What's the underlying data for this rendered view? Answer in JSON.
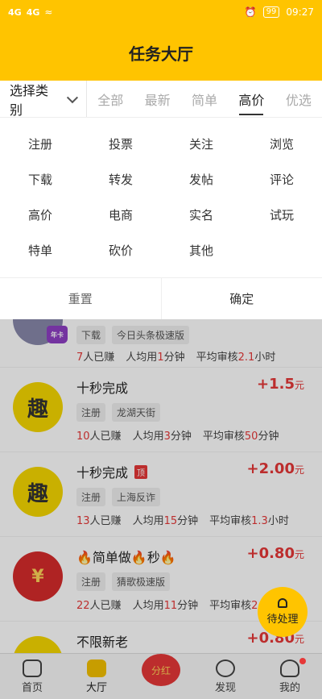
{
  "status": {
    "time": "09:27",
    "battery": "99",
    "signal1": "4G",
    "signal2": "4G"
  },
  "header": {
    "title": "任务大厅"
  },
  "tabs": {
    "category": "选择类别",
    "items": [
      {
        "label": "全部",
        "active": false
      },
      {
        "label": "最新",
        "active": false
      },
      {
        "label": "简单",
        "active": false
      },
      {
        "label": "高价",
        "active": true
      },
      {
        "label": "优选",
        "active": false
      }
    ]
  },
  "filter": {
    "options": [
      "注册",
      "投票",
      "关注",
      "浏览",
      "下载",
      "转发",
      "发帖",
      "评论",
      "高价",
      "电商",
      "实名",
      "试玩",
      "特单",
      "砍价",
      "其他"
    ],
    "reset": "重置",
    "confirm": "确定"
  },
  "list": [
    {
      "title": "",
      "price": "",
      "tags": [
        "下载",
        "今日头条极速版"
      ],
      "earned": "7",
      "earned_label": "人已赚",
      "avg_time": "1",
      "audit": "2.1",
      "audit_unit": "小时",
      "thumb": "photo",
      "top": false
    },
    {
      "title": "十秒完成",
      "price": "+1.5",
      "tags": [
        "注册",
        "龙湖天街"
      ],
      "earned": "10",
      "earned_label": "人已赚",
      "avg_time": "3",
      "audit": "50",
      "audit_unit": "分钟",
      "thumb": "趣",
      "top": false
    },
    {
      "title": "十秒完成",
      "price": "+2.00",
      "tags": [
        "注册",
        "上海反诈"
      ],
      "earned": "13",
      "earned_label": "人已赚",
      "avg_time": "15",
      "audit": "1.3",
      "audit_unit": "小时",
      "thumb": "趣",
      "top": true
    },
    {
      "title": "🔥简单做🔥秒🔥",
      "price": "+0.80",
      "tags": [
        "注册",
        "猜歌极速版"
      ],
      "earned": "22",
      "earned_label": "人已赚",
      "avg_time": "11",
      "audit": "2.2",
      "audit_unit": "小时",
      "thumb": "¥",
      "top": false
    },
    {
      "title": "不限新老",
      "price": "+0.80",
      "tags": [],
      "earned": "",
      "earned_label": "",
      "avg_time": "",
      "audit": "",
      "audit_unit": "",
      "thumb": "",
      "top": false
    }
  ],
  "labels": {
    "avg_prefix": "人均用",
    "avg_unit": "分钟",
    "audit_prefix": "平均审核",
    "currency": "元",
    "top_badge": "顶"
  },
  "fab": {
    "label": "待处理"
  },
  "nav": [
    {
      "label": "首页"
    },
    {
      "label": "大厅"
    },
    {
      "label": "分红"
    },
    {
      "label": "发现"
    },
    {
      "label": "我的"
    }
  ],
  "colors": {
    "accent": "#ffc400",
    "price": "#e63838"
  }
}
